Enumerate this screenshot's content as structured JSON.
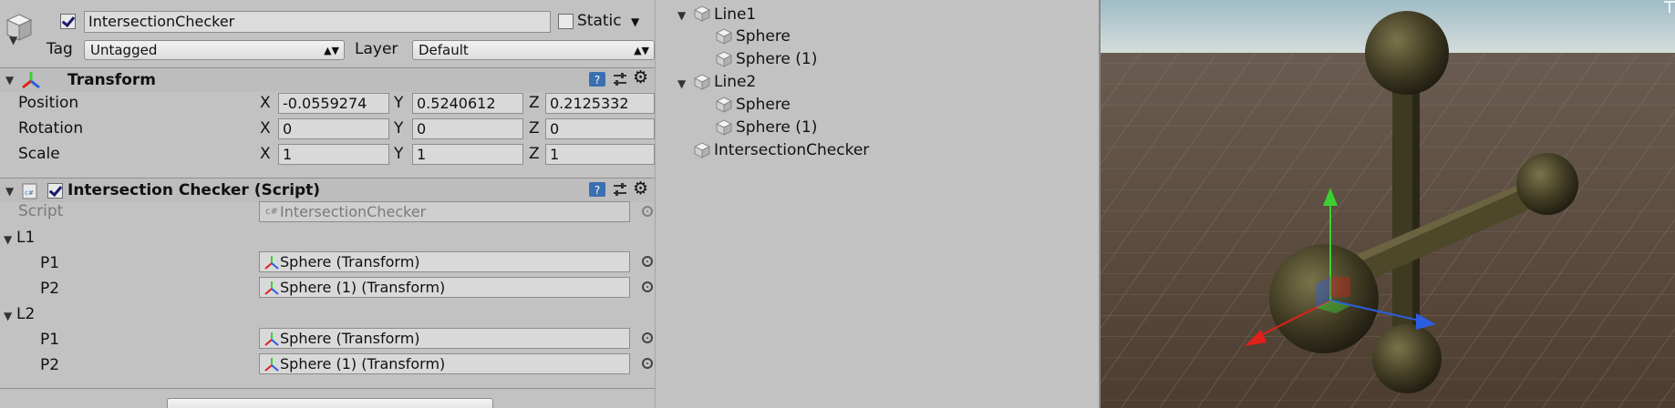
{
  "inspector": {
    "object_name": "IntersectionChecker",
    "active": true,
    "static_label": "Static",
    "tag_label": "Tag",
    "tag_value": "Untagged",
    "layer_label": "Layer",
    "layer_value": "Default",
    "transform": {
      "title": "Transform",
      "rows": [
        {
          "label": "Position",
          "x": "-0.0559274",
          "y": "0.5240612",
          "z": "0.2125332"
        },
        {
          "label": "Rotation",
          "x": "0",
          "y": "0",
          "z": "0"
        },
        {
          "label": "Scale",
          "x": "1",
          "y": "1",
          "z": "1"
        }
      ],
      "axis": {
        "x": "X",
        "y": "Y",
        "z": "Z"
      }
    },
    "script_component": {
      "title": "Intersection Checker (Script)",
      "enabled": true,
      "script_label": "Script",
      "script_value": "IntersectionChecker",
      "groups": [
        {
          "name": "L1",
          "p1_label": "P1",
          "p1_value": "Sphere (Transform)",
          "p2_label": "P2",
          "p2_value": "Sphere (1) (Transform)"
        },
        {
          "name": "L2",
          "p1_label": "P1",
          "p1_value": "Sphere (Transform)",
          "p2_label": "P2",
          "p2_value": "Sphere (1) (Transform)"
        }
      ]
    }
  },
  "hierarchy": {
    "items": [
      {
        "label": "Line1"
      },
      {
        "label": "Sphere"
      },
      {
        "label": "Sphere (1)"
      },
      {
        "label": "Line2"
      },
      {
        "label": "Sphere"
      },
      {
        "label": "Sphere (1)"
      },
      {
        "label": "IntersectionChecker"
      }
    ]
  },
  "colors": {
    "panel": "#c2c2c2",
    "sky": "#b8cfd6",
    "ground": "#5a4a3b",
    "object": "#4f4a2e",
    "gizmo_x": "#e0201a",
    "gizmo_y": "#3ccf32",
    "gizmo_z": "#2a5de0"
  }
}
